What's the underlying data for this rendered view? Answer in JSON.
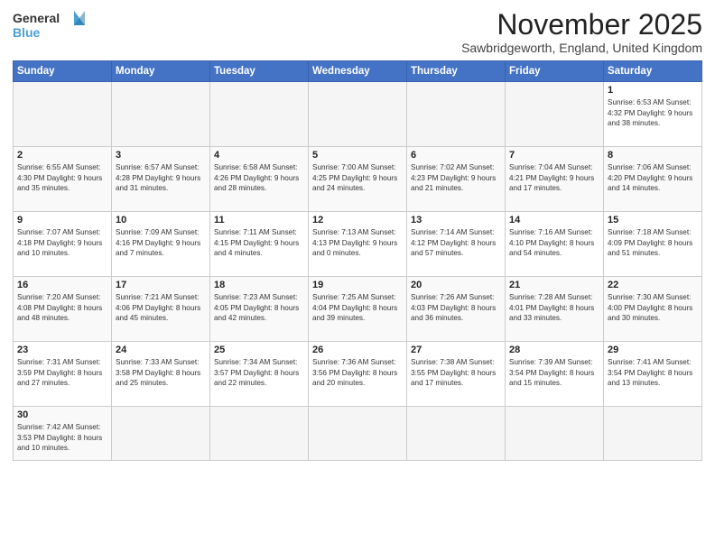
{
  "logo": {
    "line1": "General",
    "line2": "Blue"
  },
  "header": {
    "month": "November 2025",
    "location": "Sawbridgeworth, England, United Kingdom"
  },
  "weekdays": [
    "Sunday",
    "Monday",
    "Tuesday",
    "Wednesday",
    "Thursday",
    "Friday",
    "Saturday"
  ],
  "weeks": [
    [
      {
        "day": "",
        "info": ""
      },
      {
        "day": "",
        "info": ""
      },
      {
        "day": "",
        "info": ""
      },
      {
        "day": "",
        "info": ""
      },
      {
        "day": "",
        "info": ""
      },
      {
        "day": "",
        "info": ""
      },
      {
        "day": "1",
        "info": "Sunrise: 6:53 AM\nSunset: 4:32 PM\nDaylight: 9 hours and 38 minutes."
      }
    ],
    [
      {
        "day": "2",
        "info": "Sunrise: 6:55 AM\nSunset: 4:30 PM\nDaylight: 9 hours and 35 minutes."
      },
      {
        "day": "3",
        "info": "Sunrise: 6:57 AM\nSunset: 4:28 PM\nDaylight: 9 hours and 31 minutes."
      },
      {
        "day": "4",
        "info": "Sunrise: 6:58 AM\nSunset: 4:26 PM\nDaylight: 9 hours and 28 minutes."
      },
      {
        "day": "5",
        "info": "Sunrise: 7:00 AM\nSunset: 4:25 PM\nDaylight: 9 hours and 24 minutes."
      },
      {
        "day": "6",
        "info": "Sunrise: 7:02 AM\nSunset: 4:23 PM\nDaylight: 9 hours and 21 minutes."
      },
      {
        "day": "7",
        "info": "Sunrise: 7:04 AM\nSunset: 4:21 PM\nDaylight: 9 hours and 17 minutes."
      },
      {
        "day": "8",
        "info": "Sunrise: 7:06 AM\nSunset: 4:20 PM\nDaylight: 9 hours and 14 minutes."
      }
    ],
    [
      {
        "day": "9",
        "info": "Sunrise: 7:07 AM\nSunset: 4:18 PM\nDaylight: 9 hours and 10 minutes."
      },
      {
        "day": "10",
        "info": "Sunrise: 7:09 AM\nSunset: 4:16 PM\nDaylight: 9 hours and 7 minutes."
      },
      {
        "day": "11",
        "info": "Sunrise: 7:11 AM\nSunset: 4:15 PM\nDaylight: 9 hours and 4 minutes."
      },
      {
        "day": "12",
        "info": "Sunrise: 7:13 AM\nSunset: 4:13 PM\nDaylight: 9 hours and 0 minutes."
      },
      {
        "day": "13",
        "info": "Sunrise: 7:14 AM\nSunset: 4:12 PM\nDaylight: 8 hours and 57 minutes."
      },
      {
        "day": "14",
        "info": "Sunrise: 7:16 AM\nSunset: 4:10 PM\nDaylight: 8 hours and 54 minutes."
      },
      {
        "day": "15",
        "info": "Sunrise: 7:18 AM\nSunset: 4:09 PM\nDaylight: 8 hours and 51 minutes."
      }
    ],
    [
      {
        "day": "16",
        "info": "Sunrise: 7:20 AM\nSunset: 4:08 PM\nDaylight: 8 hours and 48 minutes."
      },
      {
        "day": "17",
        "info": "Sunrise: 7:21 AM\nSunset: 4:06 PM\nDaylight: 8 hours and 45 minutes."
      },
      {
        "day": "18",
        "info": "Sunrise: 7:23 AM\nSunset: 4:05 PM\nDaylight: 8 hours and 42 minutes."
      },
      {
        "day": "19",
        "info": "Sunrise: 7:25 AM\nSunset: 4:04 PM\nDaylight: 8 hours and 39 minutes."
      },
      {
        "day": "20",
        "info": "Sunrise: 7:26 AM\nSunset: 4:03 PM\nDaylight: 8 hours and 36 minutes."
      },
      {
        "day": "21",
        "info": "Sunrise: 7:28 AM\nSunset: 4:01 PM\nDaylight: 8 hours and 33 minutes."
      },
      {
        "day": "22",
        "info": "Sunrise: 7:30 AM\nSunset: 4:00 PM\nDaylight: 8 hours and 30 minutes."
      }
    ],
    [
      {
        "day": "23",
        "info": "Sunrise: 7:31 AM\nSunset: 3:59 PM\nDaylight: 8 hours and 27 minutes."
      },
      {
        "day": "24",
        "info": "Sunrise: 7:33 AM\nSunset: 3:58 PM\nDaylight: 8 hours and 25 minutes."
      },
      {
        "day": "25",
        "info": "Sunrise: 7:34 AM\nSunset: 3:57 PM\nDaylight: 8 hours and 22 minutes."
      },
      {
        "day": "26",
        "info": "Sunrise: 7:36 AM\nSunset: 3:56 PM\nDaylight: 8 hours and 20 minutes."
      },
      {
        "day": "27",
        "info": "Sunrise: 7:38 AM\nSunset: 3:55 PM\nDaylight: 8 hours and 17 minutes."
      },
      {
        "day": "28",
        "info": "Sunrise: 7:39 AM\nSunset: 3:54 PM\nDaylight: 8 hours and 15 minutes."
      },
      {
        "day": "29",
        "info": "Sunrise: 7:41 AM\nSunset: 3:54 PM\nDaylight: 8 hours and 13 minutes."
      }
    ],
    [
      {
        "day": "30",
        "info": "Sunrise: 7:42 AM\nSunset: 3:53 PM\nDaylight: 8 hours and 10 minutes."
      },
      {
        "day": "",
        "info": ""
      },
      {
        "day": "",
        "info": ""
      },
      {
        "day": "",
        "info": ""
      },
      {
        "day": "",
        "info": ""
      },
      {
        "day": "",
        "info": ""
      },
      {
        "day": "",
        "info": ""
      }
    ]
  ]
}
